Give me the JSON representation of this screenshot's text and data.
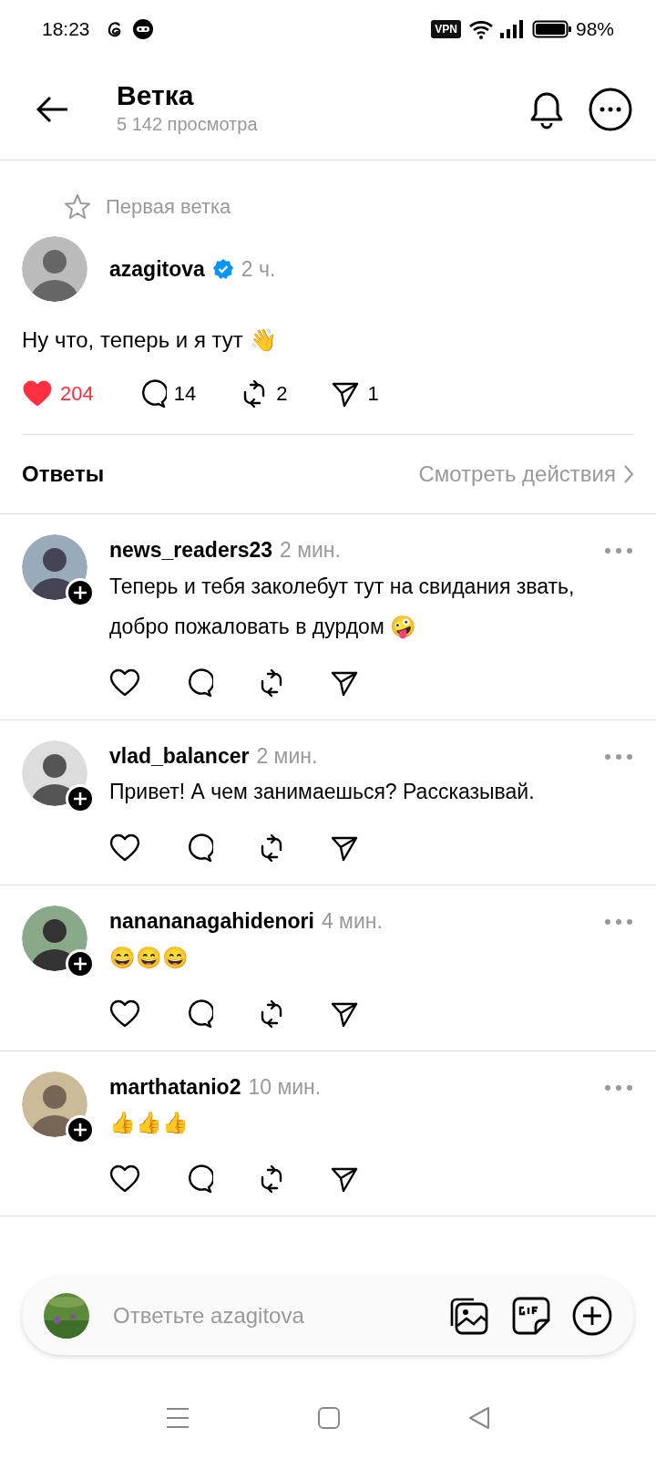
{
  "status_bar": {
    "time": "18:23",
    "vpn": "VPN",
    "battery": "98%"
  },
  "header": {
    "title": "Ветка",
    "subtitle": "5 142 просмотра"
  },
  "post": {
    "pinned_label": "Первая ветка",
    "author": "azagitova",
    "verified": true,
    "time": "2 ч.",
    "text": "Ну что, теперь и я тут 👋",
    "liked": true,
    "likes": "204",
    "replies": "14",
    "reposts": "2",
    "shares": "1"
  },
  "replies_header": {
    "title": "Ответы",
    "link": "Смотреть действия"
  },
  "replies": [
    {
      "author": "news_readers23",
      "time": "2 мин.",
      "text": "Теперь и тебя заколебут тут на свидания звать, добро пожаловать в дурдом 🤪",
      "liked": false
    },
    {
      "author": "vlad_balancer",
      "time": "2 мин.",
      "text": "Привет! А чем занимаешься? Рассказывай.",
      "liked": false
    },
    {
      "author": "nanananagahidenori",
      "time": "4 мин.",
      "text": "😄😄😄",
      "liked": false
    },
    {
      "author": "marthatanio2",
      "time": "10 мин.",
      "text": "👍👍👍",
      "liked": false
    }
  ],
  "reply_bar": {
    "placeholder": "Ответьте azagitova"
  }
}
